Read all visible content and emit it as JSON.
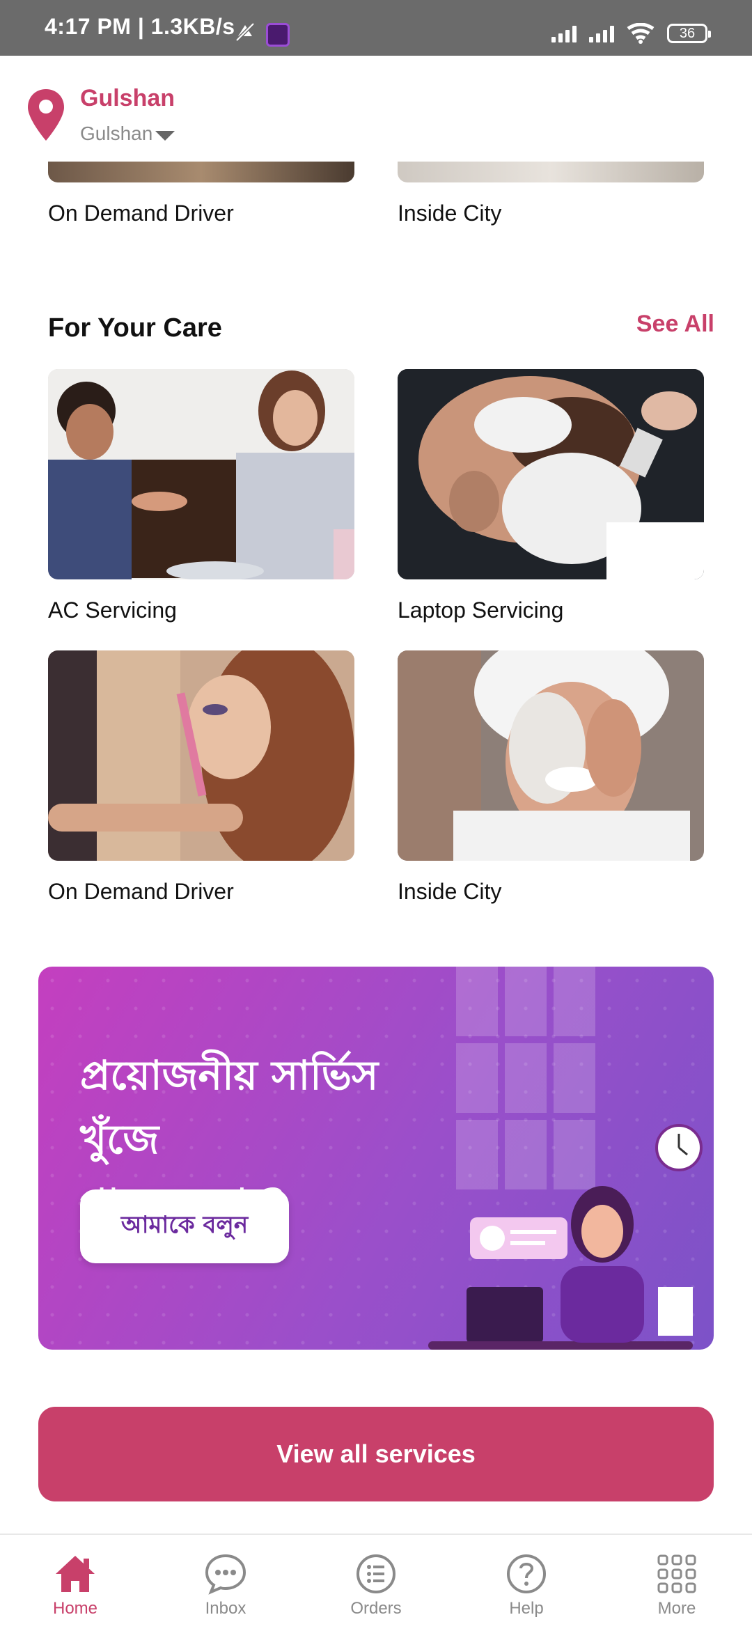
{
  "status_bar": {
    "time_text": "4:17 PM | 1.3KB/s",
    "battery": "36"
  },
  "location": {
    "title": "Gulshan",
    "selected_area": "Gulshan"
  },
  "top_row": {
    "left_label": "On Demand Driver",
    "right_label": "Inside City"
  },
  "section": {
    "title": "For Your Care",
    "see_all": "See All",
    "items": [
      {
        "label": "AC Servicing",
        "image": "manicure-photo"
      },
      {
        "label": "Laptop Servicing",
        "image": "shaving-photo"
      },
      {
        "label": "On Demand Driver",
        "image": "makeup-photo"
      },
      {
        "label": "Inside City",
        "image": "face-mask-photo"
      }
    ]
  },
  "banner": {
    "line1": "প্রয়োজনীয় সার্ভিস খুঁজে",
    "line2": "পাচ্ছেন না ?",
    "button": "আমাকে বলুন",
    "illustration": "support-agent-illustration"
  },
  "view_all_button": "View all services",
  "bottom_nav": [
    {
      "label": "Home",
      "icon": "home-icon",
      "active": true
    },
    {
      "label": "Inbox",
      "icon": "chat-icon",
      "active": false
    },
    {
      "label": "Orders",
      "icon": "list-icon",
      "active": false
    },
    {
      "label": "Help",
      "icon": "help-icon",
      "active": false
    },
    {
      "label": "More",
      "icon": "grid-icon",
      "active": false
    }
  ],
  "colors": {
    "accent": "#c8406a",
    "banner_start": "#c43fbf",
    "banner_end": "#7c52c8",
    "status_bar": "#6b6b6b"
  }
}
